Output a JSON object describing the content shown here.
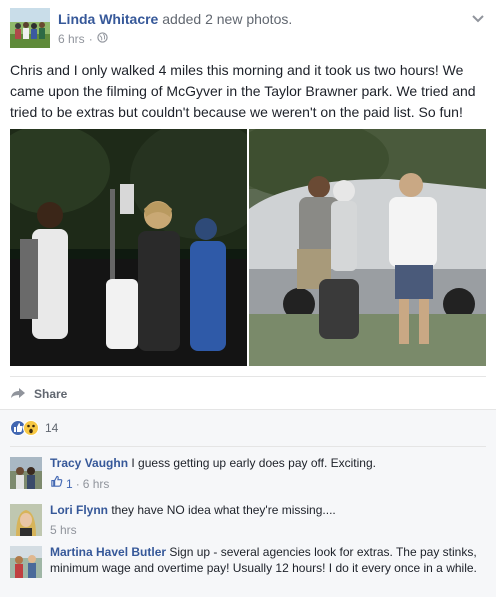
{
  "post": {
    "author": "Linda Whitacre",
    "action": "added 2 new photos.",
    "time": "6 hrs",
    "separator": "·",
    "privacy_icon": "globe-icon",
    "text": "Chris and I only walked 4 miles this morning and it took us two hours! We came upon the filming of McGyver in the Taylor Brawner park. We tried and tried to be extras but couldn't because we weren't on the paid list. So fun!",
    "share_label": "Share",
    "reaction_count": "14"
  },
  "comments": [
    {
      "name": "Tracy Vaughn",
      "text": "I guess getting up early does pay off. Exciting.",
      "likes": "1",
      "time": "6 hrs",
      "separator": "·"
    },
    {
      "name": "Lori Flynn",
      "text": "they have NO idea what they're missing....",
      "time": "5 hrs"
    },
    {
      "name": "Martina Havel Butler",
      "text": "Sign up - several agencies look for extras. The pay stinks, minimum wage and overtime pay! Usually 12 hours! I do it every once in a while."
    }
  ],
  "colors": {
    "link": "#365899",
    "meta": "#90949c",
    "like_blue": "#4267b2",
    "wow_yellow": "#f7c844",
    "comments_bg": "#f6f7f9"
  }
}
